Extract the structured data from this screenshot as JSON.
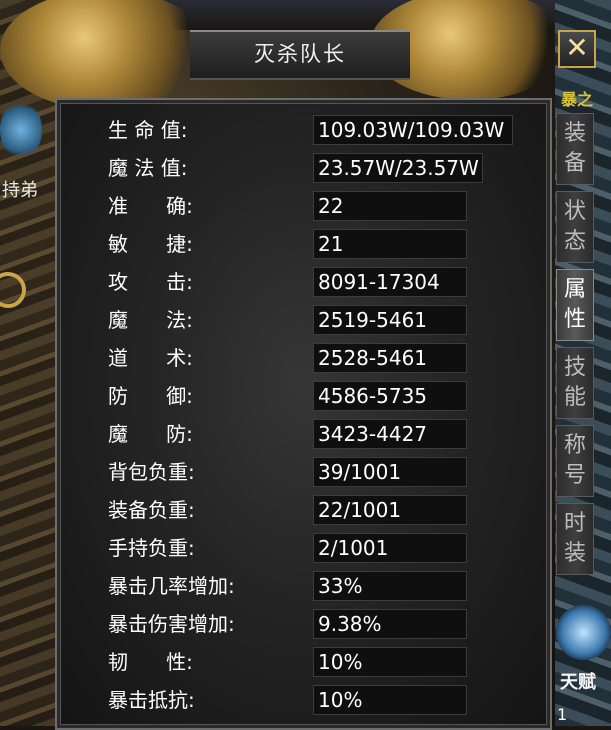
{
  "window": {
    "title": "灭杀队长",
    "close_icon": "crossed-swords-icon"
  },
  "stats": [
    {
      "label": "生 命 值:",
      "value": "109.03W/109.03W"
    },
    {
      "label": "魔 法 值:",
      "value": "23.57W/23.57W"
    },
    {
      "label": "准      确:",
      "value": "22"
    },
    {
      "label": "敏      捷:",
      "value": "21"
    },
    {
      "label": "攻      击:",
      "value": "8091-17304"
    },
    {
      "label": "魔      法:",
      "value": "2519-5461"
    },
    {
      "label": "道      术:",
      "value": "2528-5461"
    },
    {
      "label": "防      御:",
      "value": "4586-5735"
    },
    {
      "label": "魔      防:",
      "value": "3423-4427"
    },
    {
      "label": "背包负重:",
      "value": "39/1001"
    },
    {
      "label": "装备负重:",
      "value": "22/1001"
    },
    {
      "label": "手持负重:",
      "value": "2/1001"
    },
    {
      "label": "暴击几率增加:",
      "value": "33%"
    },
    {
      "label": "暴击伤害增加:",
      "value": "9.38%"
    },
    {
      "label": "韧      性:",
      "value": "10%"
    },
    {
      "label": "暴击抵抗:",
      "value": "10%"
    }
  ],
  "tabs": [
    {
      "top": "装",
      "bottom": "备",
      "active": false
    },
    {
      "top": "状",
      "bottom": "态",
      "active": false
    },
    {
      "top": "属",
      "bottom": "性",
      "active": true
    },
    {
      "top": "技",
      "bottom": "能",
      "active": false
    },
    {
      "top": "称",
      "bottom": "号",
      "active": false
    },
    {
      "top": "时",
      "bottom": "装",
      "active": false
    }
  ],
  "background": {
    "left_label": "持弟",
    "right_top_label": "暴之",
    "right_bottom_label": "天赋",
    "bottom_right_digit": "1"
  },
  "colors": {
    "panel": "#242424",
    "text": "#ffffff",
    "frame_gold": "#c9a54a"
  }
}
